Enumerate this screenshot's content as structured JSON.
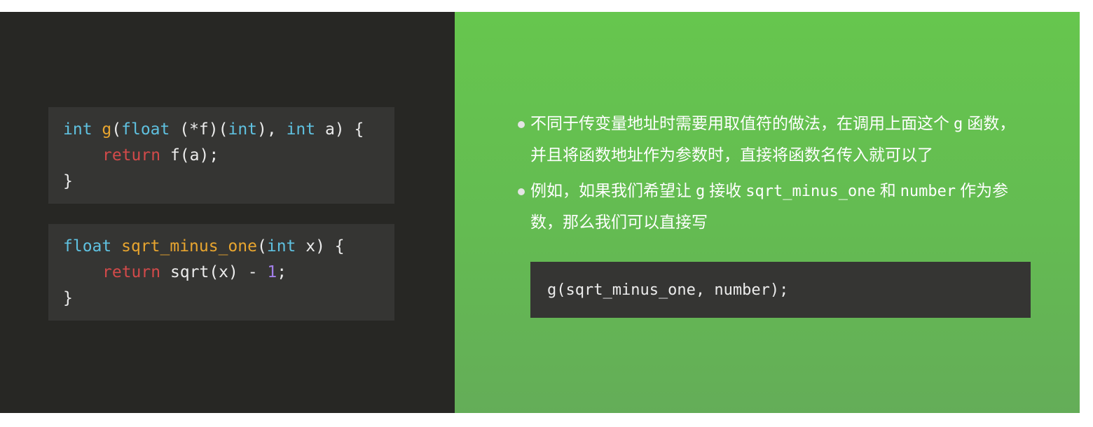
{
  "colors": {
    "left_bg": "#272724",
    "right_bg": "#66c64e",
    "code_bg": "#353533",
    "type": "#5fc1e0",
    "function": "#e8a52f",
    "keyword": "#d34a4a",
    "number": "#a27fe8"
  },
  "code_block_1": {
    "l1": {
      "t1": "int",
      "t2": " ",
      "t3": "g",
      "t4": "(",
      "t5": "float",
      "t6": " (*f)(",
      "t7": "int",
      "t8": "), ",
      "t9": "int",
      "t10": " a) {"
    },
    "l2": {
      "t1": "return",
      "t2": " f(a);"
    },
    "l3": {
      "t1": "}"
    }
  },
  "code_block_2": {
    "l1": {
      "t1": "float",
      "t2": " ",
      "t3": "sqrt_minus_one",
      "t4": "(",
      "t5": "int",
      "t6": " x) {"
    },
    "l2": {
      "t1": "return",
      "t2": " sqrt(x) - ",
      "t3": "1",
      "t4": ";"
    },
    "l3": {
      "t1": "}"
    }
  },
  "bullets": {
    "b1": {
      "p1": "不同于传变量地址时需要用取值符的做法，在调用上面这个",
      "c1": "g",
      "p2": "函数，并且将函数地址作为参数时，直接将函数名传入就可以了"
    },
    "b2": {
      "p1": "例如，如果我们希望让",
      "c1": "g",
      "p2": "接收",
      "c2": "sqrt_minus_one",
      "p3": "和",
      "c3": "number",
      "p4": "作为参数，那么我们可以直接写"
    }
  },
  "code_block_3": {
    "l1": "g(sqrt_minus_one, number);"
  }
}
